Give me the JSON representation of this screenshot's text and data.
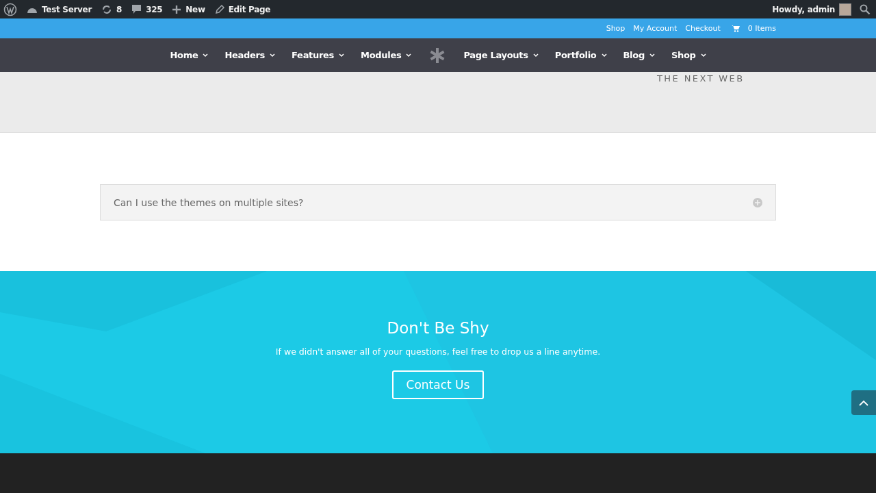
{
  "admin_bar": {
    "site": "Test Server",
    "updates": "8",
    "comments": "325",
    "new": "New",
    "edit": "Edit Page",
    "greeting": "Howdy, admin"
  },
  "top_bar": {
    "links": [
      "Shop",
      "My Account",
      "Checkout"
    ],
    "cart": "0 Items"
  },
  "nav": {
    "left": [
      {
        "label": "Home"
      },
      {
        "label": "Headers"
      },
      {
        "label": "Features"
      },
      {
        "label": "Modules"
      }
    ],
    "right": [
      {
        "label": "Page Layouts"
      },
      {
        "label": "Portfolio"
      },
      {
        "label": "Blog"
      },
      {
        "label": "Shop"
      }
    ]
  },
  "logos": {
    "visible": "THE NEXT WEB"
  },
  "accordion": [
    {
      "question": "Can I use the themes on multiple sites?",
      "expanded": false
    }
  ],
  "cta": {
    "title": "Don't Be Shy",
    "text": "If we didn't answer all of your questions, feel free to drop us a line anytime.",
    "button": "Contact Us"
  }
}
